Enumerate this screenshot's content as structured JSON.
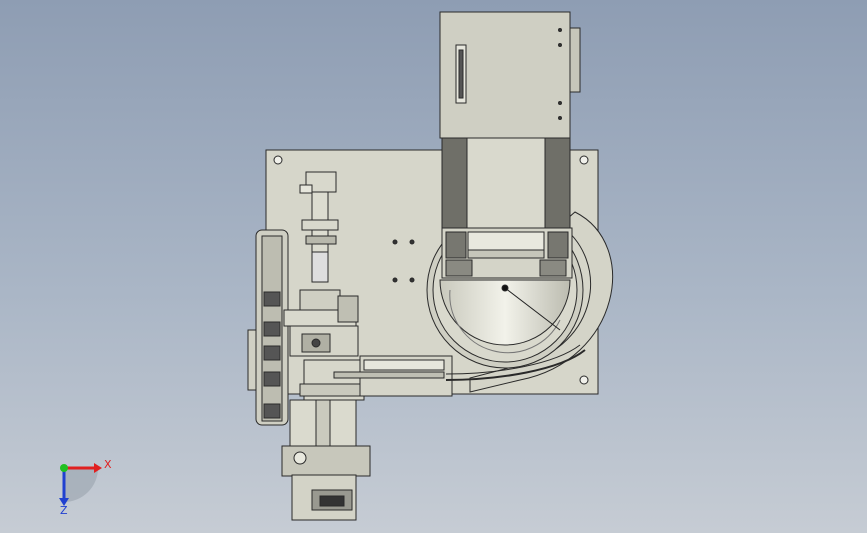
{
  "viewport": {
    "background_top": "#8e9db3",
    "background_bottom": "#c6ccd4",
    "part_fill": "#d8d8cc",
    "part_stroke": "#2a2a2a"
  },
  "triad": {
    "x_label": "X",
    "z_label": "Z",
    "x_color": "#e02020",
    "y_color": "#20c020",
    "z_color": "#2040d0"
  }
}
